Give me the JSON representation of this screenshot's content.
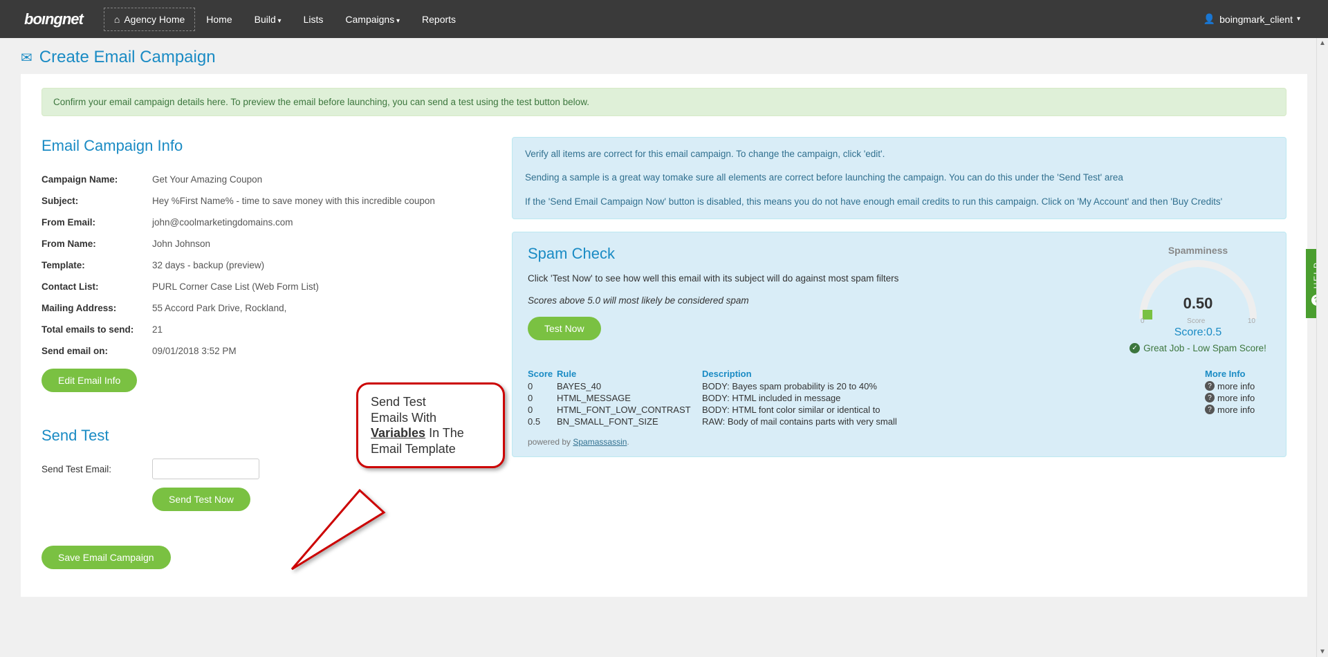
{
  "nav": {
    "logo": "boıngnet",
    "agency_home": "Agency Home",
    "items": [
      "Home",
      "Build",
      "Lists",
      "Campaigns",
      "Reports"
    ],
    "user": "boingmark_client"
  },
  "page_title": "Create Email Campaign",
  "confirm_alert": "Confirm your email campaign details here. To preview the email before launching, you can send a test using the test button below.",
  "info": {
    "heading": "Email Campaign Info",
    "rows": [
      {
        "label": "Campaign Name:",
        "value": "Get Your Amazing Coupon"
      },
      {
        "label": "Subject:",
        "value": "Hey %First Name% - time to save money with this incredible coupon"
      },
      {
        "label": "From Email:",
        "value": "john@coolmarketingdomains.com"
      },
      {
        "label": "From Name:",
        "value": "John Johnson"
      },
      {
        "label": "Template:",
        "value": "32 days - backup (preview)"
      },
      {
        "label": "Contact List:",
        "value": "PURL Corner Case List (Web Form List)"
      },
      {
        "label": "Mailing Address:",
        "value": "55 Accord Park Drive, Rockland,"
      },
      {
        "label": "Total emails to send:",
        "value": "21"
      },
      {
        "label": "Send email on:",
        "value": "09/01/2018 3:52 PM"
      }
    ],
    "edit_btn": "Edit Email Info"
  },
  "send_test": {
    "heading": "Send Test",
    "label": "Send Test Email:",
    "value": "",
    "btn": "Send Test Now"
  },
  "save_btn": "Save Email Campaign",
  "verify_box": {
    "p1": "Verify all items are correct for this email campaign. To change the campaign, click 'edit'.",
    "p2": "Sending a sample is a great way tomake sure all elements are correct before launching the campaign. You can do this under the 'Send Test' area",
    "p3": "If the 'Send Email Campaign Now' button is disabled, this means you do not have enough email credits to run this campaign. Click on 'My Account' and then 'Buy Credits'"
  },
  "spam": {
    "heading": "Spam Check",
    "desc": "Click 'Test Now' to see how well this email with its subject will do against most spam filters",
    "note": "Scores above 5.0 will most likely be considered spam",
    "test_btn": "Test Now",
    "gauge": {
      "title": "Spamminess",
      "value": "0.50",
      "tick_min": "0",
      "tick_label": "Score",
      "tick_max": "10",
      "score_label": "Score:0.5",
      "msg": "Great Job - Low Spam Score!"
    },
    "table": {
      "h_score": "Score",
      "h_rule": "Rule",
      "h_desc": "Description",
      "h_more": "More Info",
      "rows": [
        {
          "score": "0",
          "rule": "BAYES_40",
          "desc": "BODY: Bayes spam probability is 20 to 40%",
          "more": "more info"
        },
        {
          "score": "0",
          "rule": "HTML_MESSAGE",
          "desc": "BODY: HTML included in message",
          "more": "more info"
        },
        {
          "score": "0",
          "rule": "HTML_FONT_LOW_CONTRAST",
          "desc": "BODY: HTML font color similar or identical to",
          "more": "more info"
        },
        {
          "score": "0.5",
          "rule": "BN_SMALL_FONT_SIZE",
          "desc": "RAW: Body of mail contains parts with very small",
          "more": ""
        }
      ]
    },
    "powered_prefix": "powered by ",
    "powered_link": "Spamassassin"
  },
  "callout": {
    "l1": "Send Test",
    "l2": "Emails With",
    "l3": "Variables",
    "l4": " In The",
    "l5": "Email Template"
  },
  "help_tab": "HELP"
}
